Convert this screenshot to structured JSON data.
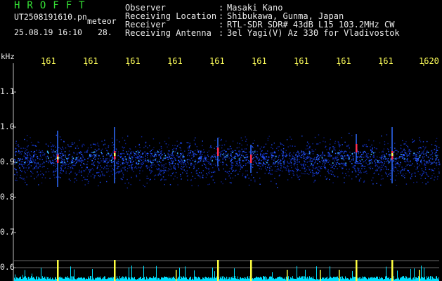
{
  "logo": "HROFFT",
  "file_name": "UT2508191610.pn",
  "label_meteor": "meteor",
  "datetime": "25.08.19 16:10",
  "count": "28.",
  "header": [
    {
      "key": "Observer",
      "sep": ":",
      "value": "Masaki Kano"
    },
    {
      "key": "Receiving Location",
      "sep": ":",
      "value": "Shibukawa, Gunma, Japan"
    },
    {
      "key": "Receiver",
      "sep": ":",
      "value": "RTL-SDR SDR# 43dB L15 103.2MHz CW"
    },
    {
      "key": "Receiving Antenna",
      "sep": ":",
      "value": "3el Yagi(V) Az 330 for Vladivostok"
    }
  ],
  "y_unit": "kHz",
  "x_ticks": [
    "161",
    "161",
    "161",
    "161",
    "161",
    "161",
    "161",
    "161",
    "161",
    "1620"
  ],
  "y_ticks": [
    "1.1",
    "1.0",
    "0.9",
    "0.8",
    "0.7",
    "0.6"
  ],
  "colors": {
    "logo": "#35e035",
    "xtick": "#ffff5a",
    "background": "#000000",
    "echo_band": "#1030c0",
    "echo_bright": "#ff3050",
    "activity": "#00e0ff"
  },
  "chart_data": {
    "type": "heatmap",
    "title": "",
    "xlabel": "",
    "ylabel": "kHz",
    "x_ticks": [
      "161",
      "161",
      "161",
      "161",
      "161",
      "161",
      "161",
      "161",
      "161",
      "1620"
    ],
    "y_ticks": [
      1.1,
      1.0,
      0.9,
      0.8,
      0.7,
      0.6
    ],
    "ylim": [
      0.58,
      1.18
    ],
    "noise_band_khz": [
      0.82,
      0.99
    ],
    "echo_events": [
      {
        "x": "1611",
        "freq_khz": 0.91,
        "strength": "strong"
      },
      {
        "x": "1612",
        "freq_khz": 0.92,
        "strength": "strong"
      },
      {
        "x": "1615",
        "freq_khz": 0.93,
        "strength": "medium"
      },
      {
        "x": "1616",
        "freq_khz": 0.91,
        "strength": "medium"
      },
      {
        "x": "1618",
        "freq_khz": 0.94,
        "strength": "medium"
      },
      {
        "x": "1619",
        "freq_khz": 0.92,
        "strength": "strong"
      }
    ]
  }
}
